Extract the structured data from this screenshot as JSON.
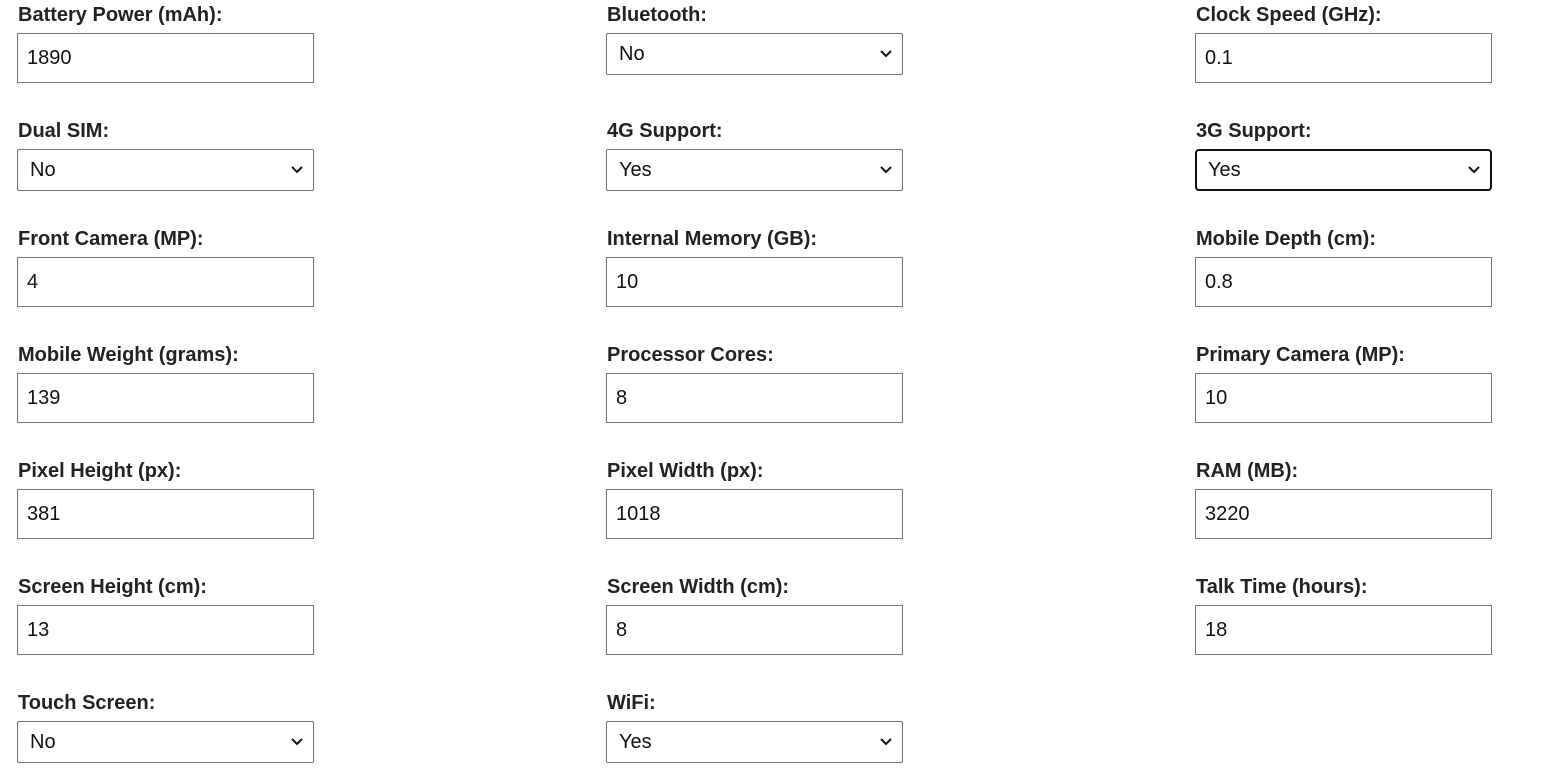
{
  "form": {
    "battery_power": {
      "label": "Battery Power (mAh):",
      "value": "1890"
    },
    "bluetooth": {
      "label": "Bluetooth:",
      "value": "No"
    },
    "clock_speed": {
      "label": "Clock Speed (GHz):",
      "value": "0.1"
    },
    "dual_sim": {
      "label": "Dual SIM:",
      "value": "No"
    },
    "four_g": {
      "label": "4G Support:",
      "value": "Yes"
    },
    "three_g": {
      "label": "3G Support:",
      "value": "Yes"
    },
    "front_camera": {
      "label": "Front Camera (MP):",
      "value": "4"
    },
    "internal_memory": {
      "label": "Internal Memory (GB):",
      "value": "10"
    },
    "mobile_depth": {
      "label": "Mobile Depth (cm):",
      "value": "0.8"
    },
    "mobile_weight": {
      "label": "Mobile Weight (grams):",
      "value": "139"
    },
    "processor_cores": {
      "label": "Processor Cores:",
      "value": "8"
    },
    "primary_camera": {
      "label": "Primary Camera (MP):",
      "value": "10"
    },
    "pixel_height": {
      "label": "Pixel Height (px):",
      "value": "381"
    },
    "pixel_width": {
      "label": "Pixel Width (px):",
      "value": "1018"
    },
    "ram": {
      "label": "RAM (MB):",
      "value": "3220"
    },
    "screen_height": {
      "label": "Screen Height (cm):",
      "value": "13"
    },
    "screen_width": {
      "label": "Screen Width (cm):",
      "value": "8"
    },
    "talk_time": {
      "label": "Talk Time (hours):",
      "value": "18"
    },
    "touch_screen": {
      "label": "Touch Screen:",
      "value": "No"
    },
    "wifi": {
      "label": "WiFi:",
      "value": "Yes"
    }
  }
}
